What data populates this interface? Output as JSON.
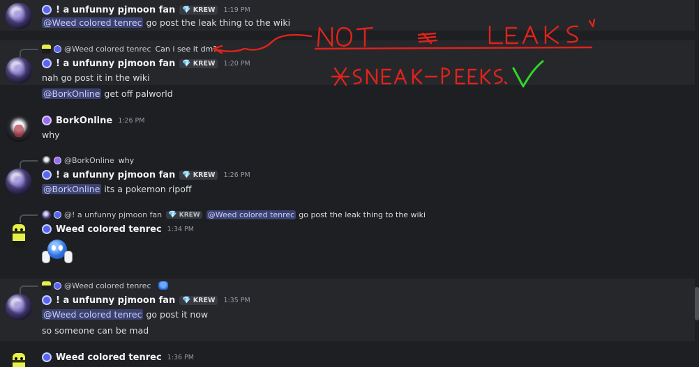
{
  "colors": {
    "background": "#1e1f22",
    "highlight": "#26272b",
    "mention_bg": "#3c4270",
    "annotation_red": "#e0231b",
    "annotation_green": "#2fd72a"
  },
  "tag_label": "KREW",
  "messages": [
    {
      "author": "! a unfunny pjmoon fan",
      "time": "1:19 PM",
      "mention": "@Weed colored tenrec",
      "text": "go post the leak thing to the wiki"
    },
    {
      "reply": {
        "author": "@Weed colored tenrec",
        "text": "Can i see it dm?"
      },
      "author": "! a unfunny pjmoon fan",
      "time": "1:20 PM",
      "text": "nah go post it in the wiki",
      "line2_mention": "@BorkOnline",
      "line2_text": "get off palworld"
    },
    {
      "author": "BorkOnline",
      "time": "1:26 PM",
      "text": "why"
    },
    {
      "reply": {
        "author": "@BorkOnline",
        "text": "why"
      },
      "author": "! a unfunny pjmoon fan",
      "time": "1:26 PM",
      "mention": "@BorkOnline",
      "text": "its a pokemon ripoff"
    },
    {
      "reply": {
        "author": "@! a unfunny pjmoon fan",
        "tag": "KREW",
        "mention": "@Weed colored tenrec",
        "text": "go post the leak thing to the wiki"
      },
      "author": "Weed colored tenrec",
      "time": "1:34 PM",
      "emoji": "thumbs-up-blue-face"
    },
    {
      "reply": {
        "author": "@Weed colored tenrec",
        "emoji": "thumbs-up-blue-face"
      },
      "author": "! a unfunny pjmoon fan",
      "time": "1:35 PM",
      "mention": "@Weed colored tenrec",
      "text": "go post it now",
      "line2_text": "so someone can be mad"
    },
    {
      "author": "Weed colored tenrec",
      "time": "1:36 PM"
    }
  ]
}
